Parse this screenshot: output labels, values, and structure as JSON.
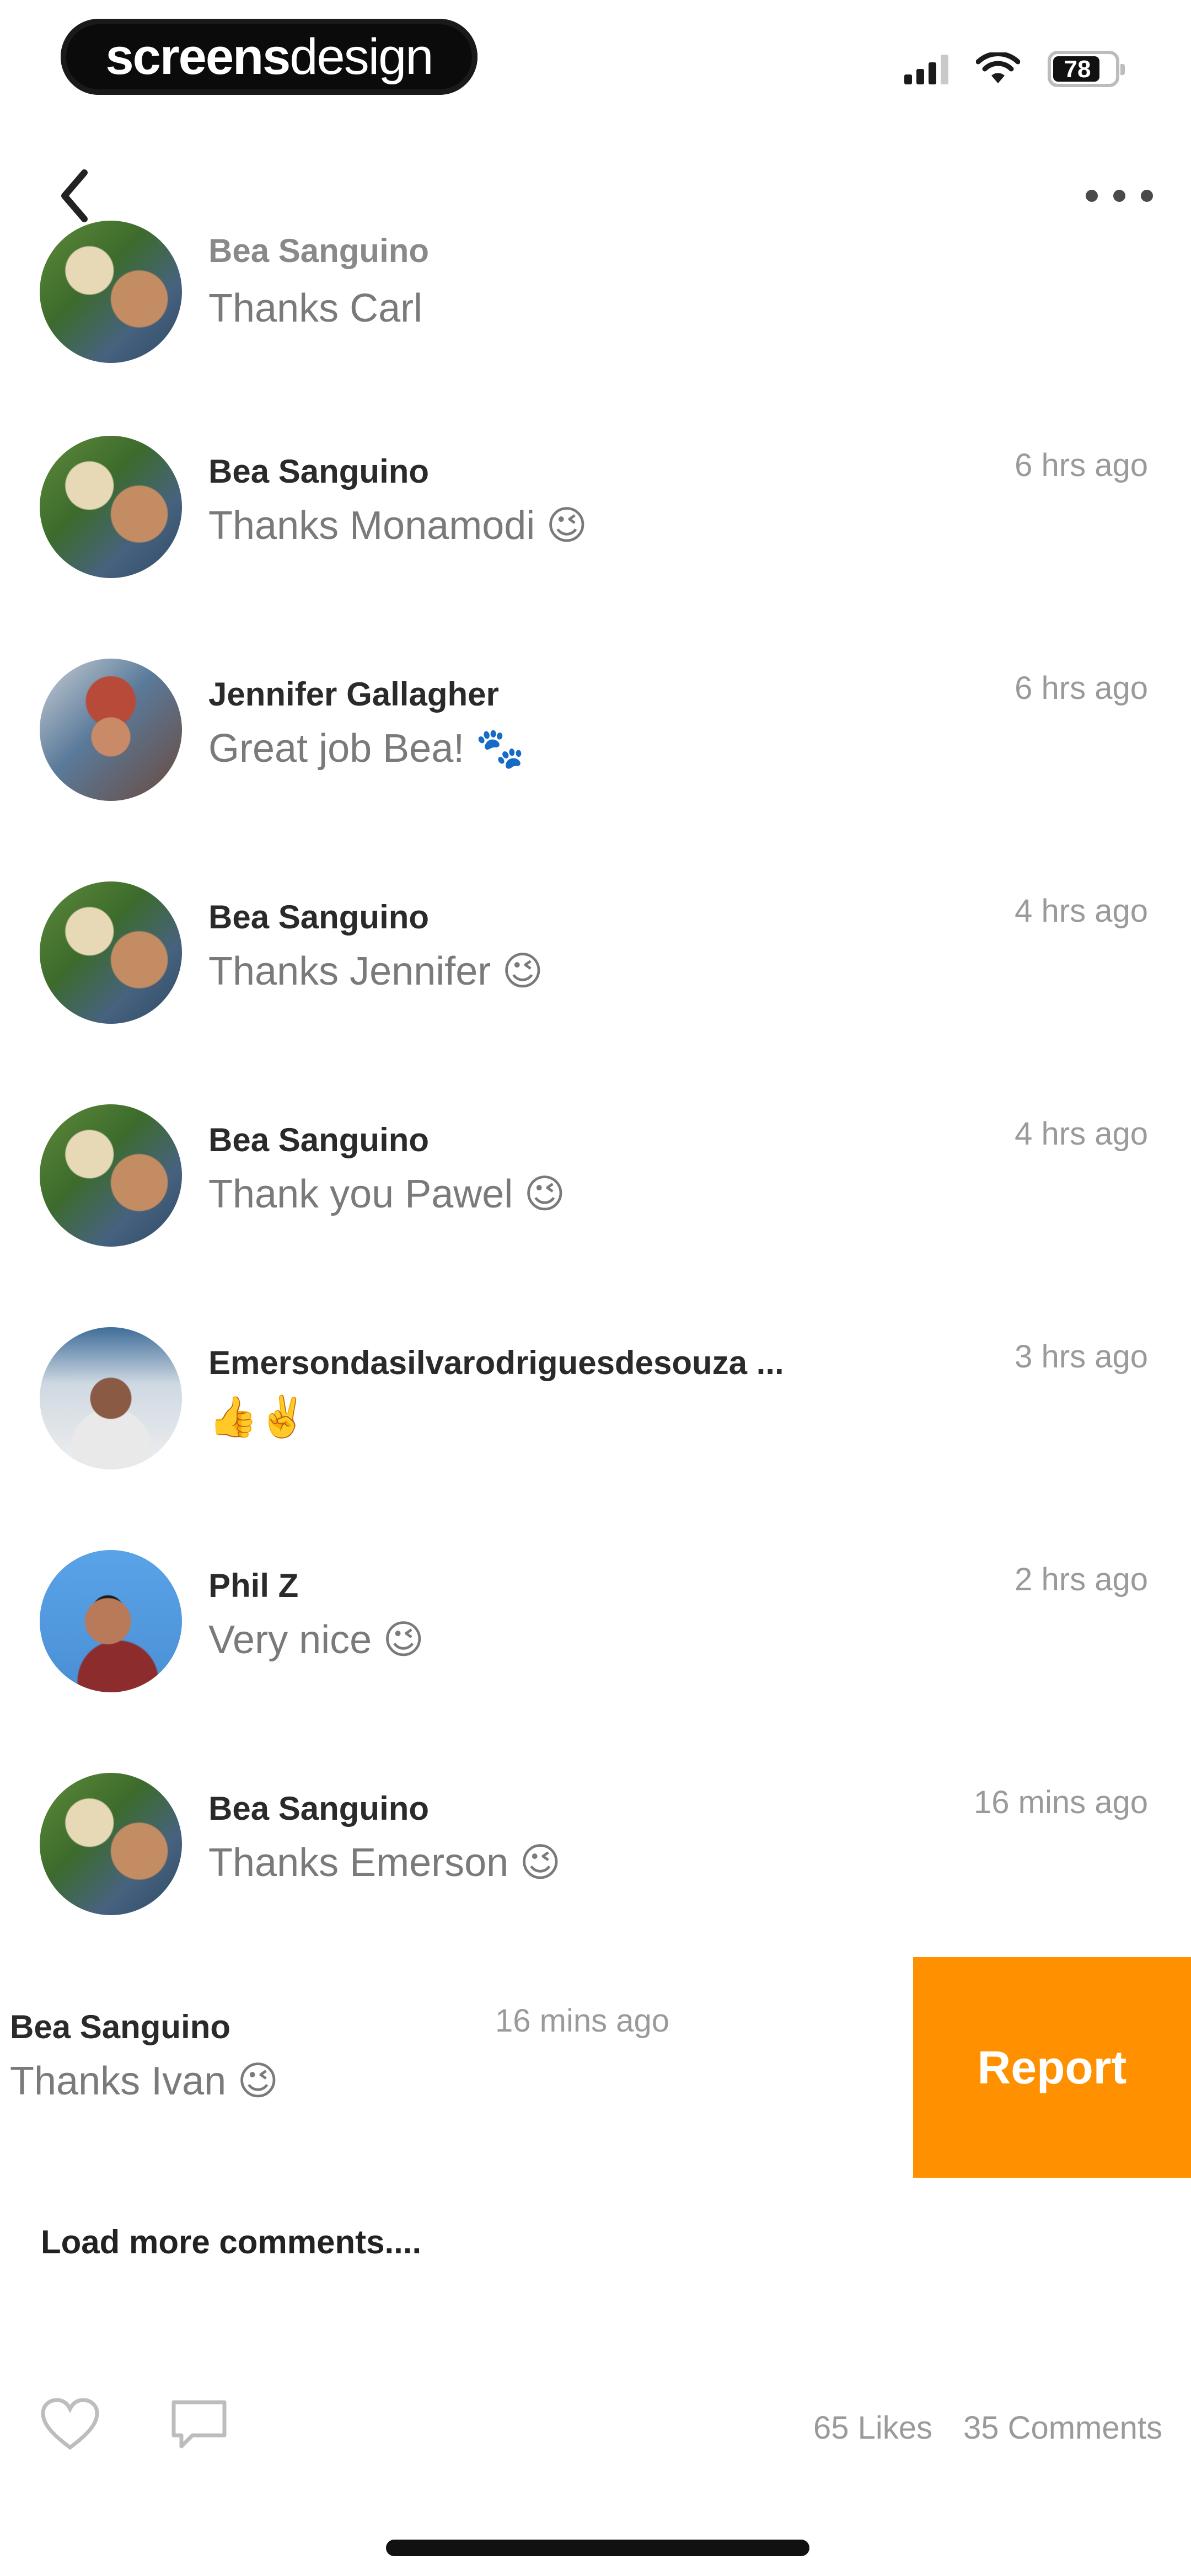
{
  "status_bar": {
    "brand_bold": "screens",
    "brand_light": "design",
    "battery_level": "78"
  },
  "nav": {
    "back_icon": "chevron-left-icon",
    "more_icon": "ellipsis-icon"
  },
  "comments": [
    {
      "name": "Bea Sanguino",
      "text": "Thanks Carl",
      "time": "",
      "avatar": "bea"
    },
    {
      "name": "Bea Sanguino",
      "text": "Thanks Monamodi 😉",
      "time": "6 hrs ago",
      "avatar": "bea"
    },
    {
      "name": "Jennifer Gallagher",
      "text": "Great job Bea! 🐾",
      "time": "6 hrs ago",
      "avatar": "jen"
    },
    {
      "name": "Bea Sanguino",
      "text": "Thanks Jennifer 😉",
      "time": "4 hrs ago",
      "avatar": "bea"
    },
    {
      "name": "Bea Sanguino",
      "text": "Thank you Pawel 😉",
      "time": "4 hrs ago",
      "avatar": "bea"
    },
    {
      "name": "Emersondasilvarodriguesdesouza ...",
      "text": "👍✌️",
      "time": "3 hrs ago",
      "avatar": "eme"
    },
    {
      "name": "Phil Z",
      "text": "Very nice 😉",
      "time": "2 hrs ago",
      "avatar": "phil"
    },
    {
      "name": "Bea Sanguino",
      "text": "Thanks Emerson 😉",
      "time": "16 mins ago",
      "avatar": "bea"
    }
  ],
  "swiped_comment": {
    "name": "Bea Sanguino",
    "text": "Thanks Ivan 😉",
    "time": "16 mins ago",
    "action_label": "Report"
  },
  "load_more_label": "Load more comments....",
  "footer": {
    "likes": "65 Likes",
    "comments": "35 Comments",
    "like_icon": "heart-icon",
    "comment_icon": "speech-bubble-icon"
  },
  "colors": {
    "accent": "#ff9000",
    "text_primary": "#2a2a2a",
    "text_secondary": "#7a7a7a",
    "text_muted": "#9a9a9a"
  }
}
